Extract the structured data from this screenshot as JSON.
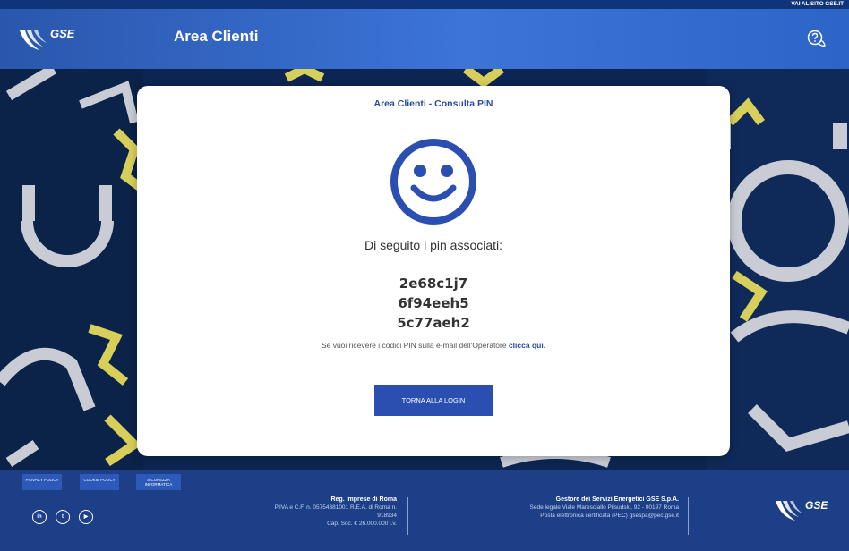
{
  "top_link": "VAI AL SITO GSE.IT",
  "header": {
    "logo_text": "GSE",
    "title": "Area Clienti"
  },
  "card": {
    "title": "Area Clienti - Consulta PIN",
    "subtitle": "Di seguito i pin associati:",
    "pins": [
      "2e68c1j7",
      "6f94eeh5",
      "5c77aeh2"
    ],
    "info_text": "Se vuoi ricevere i codici PIN sulla e-mail dell'Operatore ",
    "info_link": "clicca qui.",
    "back_button": "TORNA ALLA LOGIN"
  },
  "footer": {
    "links": [
      "PRIVACY POLICY",
      "COOKIE POLICY",
      "SICUREZZA INFORMATICA"
    ],
    "social": [
      {
        "icon": "linkedin-icon",
        "label": "in"
      },
      {
        "icon": "twitter-icon",
        "label": "t"
      },
      {
        "icon": "youtube-icon",
        "label": "▶"
      }
    ],
    "reg_title": "Reg. Imprese di Roma",
    "reg_line1": "P.IVA e C.F. n. 05754381001 R.E.A. di Roma n.",
    "reg_line2": "918934",
    "reg_line3": "Cap. Soc. € 26.000.000 i.v.",
    "company_title": "Gestore dei Servizi Energetici GSE S.p.A.",
    "company_line1": "Sede legale Viale Maresciallo Pilsudski, 92 - 00197 Roma",
    "company_line2": "Posta elettronica certificata (PEC) gsespa@pec.gse.it",
    "logo_text": "GSE"
  },
  "colors": {
    "brand_blue": "#2a4fb0",
    "header_blue": "#3c74d8",
    "footer_blue": "#1c3f88",
    "gear_yellow": "#d8cf5a"
  }
}
